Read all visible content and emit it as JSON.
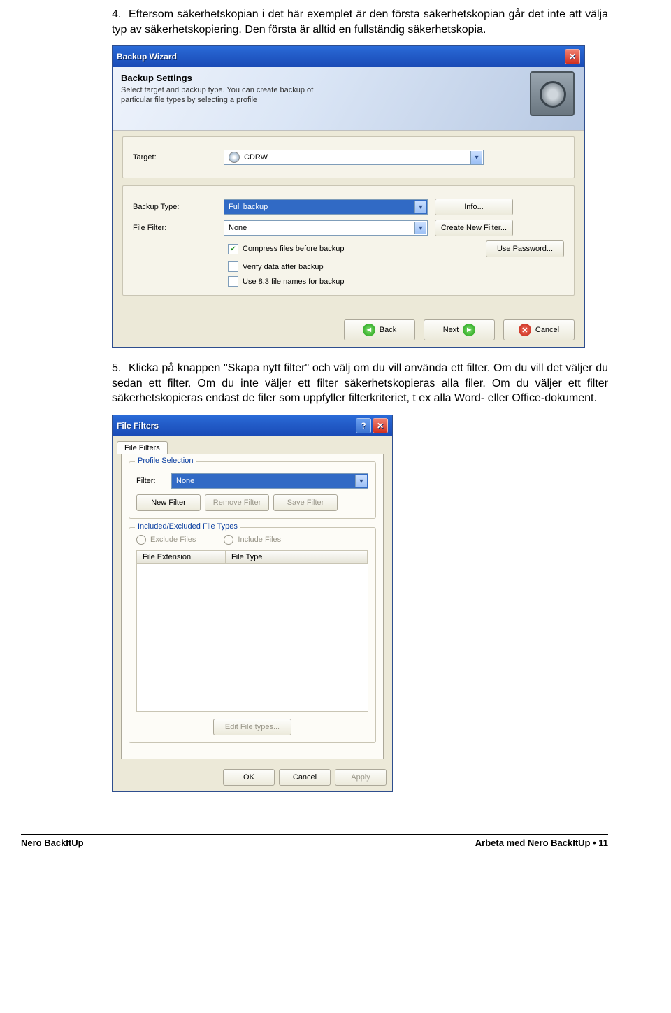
{
  "para4": {
    "num": "4.",
    "text": "Eftersom säkerhetskopian i det här exemplet är den första säkerhetskopian går det inte att välja typ av säkerhetskopiering. Den första är alltid en fullständig säkerhetskopia."
  },
  "wizard": {
    "title": "Backup Wizard",
    "banner_title": "Backup Settings",
    "banner_sub": "Select target and backup type. You can create backup of particular file types by selecting a profile",
    "target_label": "Target:",
    "target_value": "CDRW",
    "backup_type_label": "Backup Type:",
    "backup_type_value": "Full backup",
    "file_filter_label": "File Filter:",
    "file_filter_value": "None",
    "info_btn": "Info...",
    "create_filter_btn": "Create New Filter...",
    "password_btn": "Use Password...",
    "chk_compress": "Compress files before backup",
    "chk_verify": "Verify data after backup",
    "chk_83": "Use 8.3 file names for backup",
    "back_btn": "Back",
    "next_btn": "Next",
    "cancel_btn": "Cancel"
  },
  "para5": {
    "num": "5.",
    "text": "Klicka på knappen \"Skapa nytt filter\" och välj om du vill använda ett filter. Om du vill det väljer du sedan ett filter. Om du inte väljer ett filter säkerhetskopieras alla filer. Om du väljer ett filter säkerhetskopieras endast de filer som uppfyller filterkriteriet, t ex alla Word- eller Office-dokument."
  },
  "filefilters": {
    "title": "File Filters",
    "tab": "File Filters",
    "group1": "Profile Selection",
    "filter_label": "Filter:",
    "filter_value": "None",
    "new_filter": "New Filter",
    "remove_filter": "Remove Filter",
    "save_filter": "Save Filter",
    "group2": "Included/Excluded File Types",
    "exclude": "Exclude Files",
    "include": "Include Files",
    "col1": "File Extension",
    "col2": "File Type",
    "edit_btn": "Edit File types...",
    "ok": "OK",
    "cancel": "Cancel",
    "apply": "Apply"
  },
  "footer": {
    "left": "Nero BackItUp",
    "right": "Arbeta med Nero BackItUp  •  11"
  }
}
